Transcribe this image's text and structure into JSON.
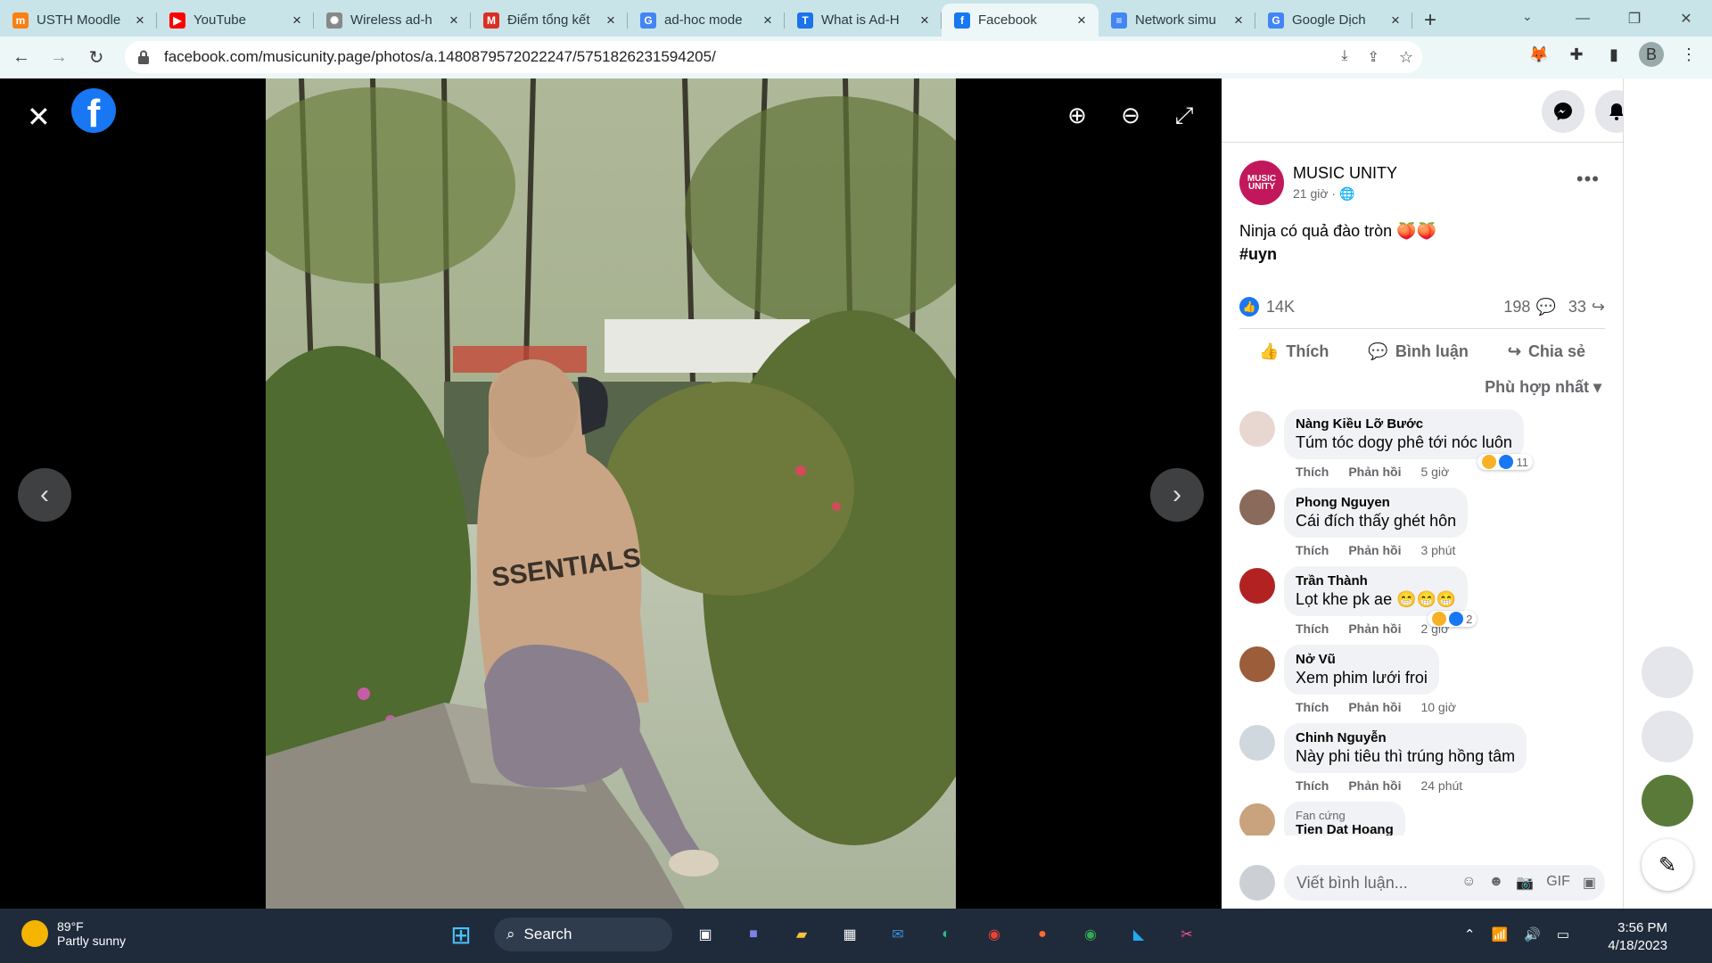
{
  "tabs": [
    {
      "title": "USTH Moodle",
      "color": "#f98012",
      "icon": "moodle-icon",
      "glyph": "m"
    },
    {
      "title": "YouTube",
      "color": "#ff0000",
      "icon": "youtube-icon",
      "glyph": "▶"
    },
    {
      "title": "Wireless ad-h",
      "color": "#888888",
      "icon": "openai-icon",
      "glyph": "✺"
    },
    {
      "title": "Điểm tổng kết",
      "color": "#d93025",
      "icon": "gmail-icon",
      "glyph": "M"
    },
    {
      "title": "ad-hoc mode",
      "color": "#4285f4",
      "icon": "google-icon",
      "glyph": "G"
    },
    {
      "title": "What is Ad-H",
      "color": "#1a73e8",
      "icon": "techtarget-icon",
      "glyph": "T"
    },
    {
      "title": "Facebook",
      "color": "#1877f2",
      "icon": "facebook-icon",
      "glyph": "f",
      "active": true
    },
    {
      "title": "Network simu",
      "color": "#4285f4",
      "icon": "docs-icon",
      "glyph": "≡"
    },
    {
      "title": "Google Dịch",
      "color": "#4285f4",
      "icon": "translate-icon",
      "glyph": "G"
    }
  ],
  "address": {
    "url": "facebook.com/musicunity.page/photos/a.1480879572022247/5751826231594205/"
  },
  "profile_initial": "B",
  "post": {
    "page_name": "MUSIC UNITY",
    "page_avatar_text": "MUSIC UNITY",
    "time": "21 giờ · 🌐",
    "text_line1": "Ninja có quả đào tròn 🍑🍑",
    "text_line2": "#uyn",
    "likes": "14K",
    "comments_count": "198",
    "shares_count": "33",
    "action_like": "Thích",
    "action_comment": "Bình luận",
    "action_share": "Chia sẻ",
    "sort_label": "Phù hợp nhất ▾"
  },
  "comments": [
    {
      "name": "Nàng Kiều Lỡ Bước",
      "text": "Túm tóc dogy phê tới nóc luôn",
      "time": "5 giờ",
      "reactions": "11",
      "avatar_color": "#e8d7d0"
    },
    {
      "name": "Phong Nguyen",
      "text": "Cái đích thấy ghét hôn",
      "time": "3 phút",
      "reactions": "",
      "avatar_color": "#8a6a5a"
    },
    {
      "name": "Trần Thành",
      "text": "Lọt khe pk ae 😁😁😁",
      "time": "2 giờ",
      "reactions": "2",
      "avatar_color": "#b22222"
    },
    {
      "name": "Nở Vũ",
      "text": "Xem phim lưới froi",
      "time": "10 giờ",
      "reactions": "",
      "avatar_color": "#9b5d3a"
    },
    {
      "name": "Chinh Nguyễn",
      "text": "Này phi tiêu thì trúng hồng tâm",
      "time": "24 phút",
      "reactions": "",
      "avatar_color": "#cfd8dc"
    },
    {
      "name": "Tien Dat Hoang",
      "text": "",
      "time": "",
      "reactions": "",
      "avatar_color": "#c9a27e",
      "badge": "Fan cứng"
    }
  ],
  "comment_labels": {
    "like": "Thích",
    "reply": "Phản hồi"
  },
  "comment_input": {
    "placeholder": "Viết bình luận..."
  },
  "taskbar": {
    "temp": "89°F",
    "weather": "Partly sunny",
    "search": "Search",
    "time": "3:56 PM",
    "date": "4/18/2023"
  }
}
